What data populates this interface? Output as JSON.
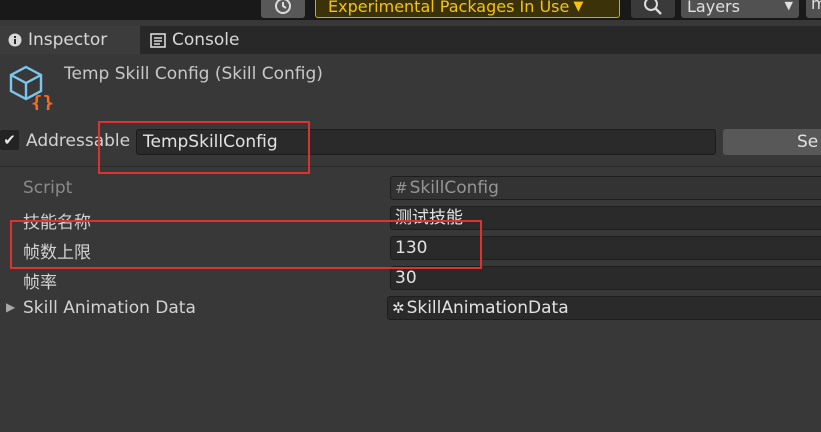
{
  "toolbar": {
    "experimental_label": "Experimental Packages In Use",
    "layers_label": "Layers",
    "layout_label": "m"
  },
  "tabs": [
    {
      "label": "Inspector"
    },
    {
      "label": "Console"
    }
  ],
  "inspector": {
    "title": "Temp Skill Config (Skill Config)",
    "addressable_label": "Addressable",
    "addressable_checked": true,
    "address_value": "TempSkillConfig",
    "select_label": "Se",
    "fields": [
      {
        "label": "Script",
        "value": "SkillConfig",
        "disabled": true,
        "value_icon": "hash-icon"
      },
      {
        "label": "技能名称",
        "value": "测试技能",
        "disabled": false
      },
      {
        "label": "帧数上限",
        "value": "130",
        "disabled": false
      },
      {
        "label": "帧率",
        "value": "30",
        "disabled": false
      },
      {
        "label": "Skill Animation Data",
        "value": "SkillAnimationData",
        "disabled": false,
        "foldout": true,
        "value_icon": "scriptable-object-icon"
      }
    ]
  },
  "colors": {
    "highlight": "#e03131",
    "accent_warning": "#f4c40e"
  }
}
